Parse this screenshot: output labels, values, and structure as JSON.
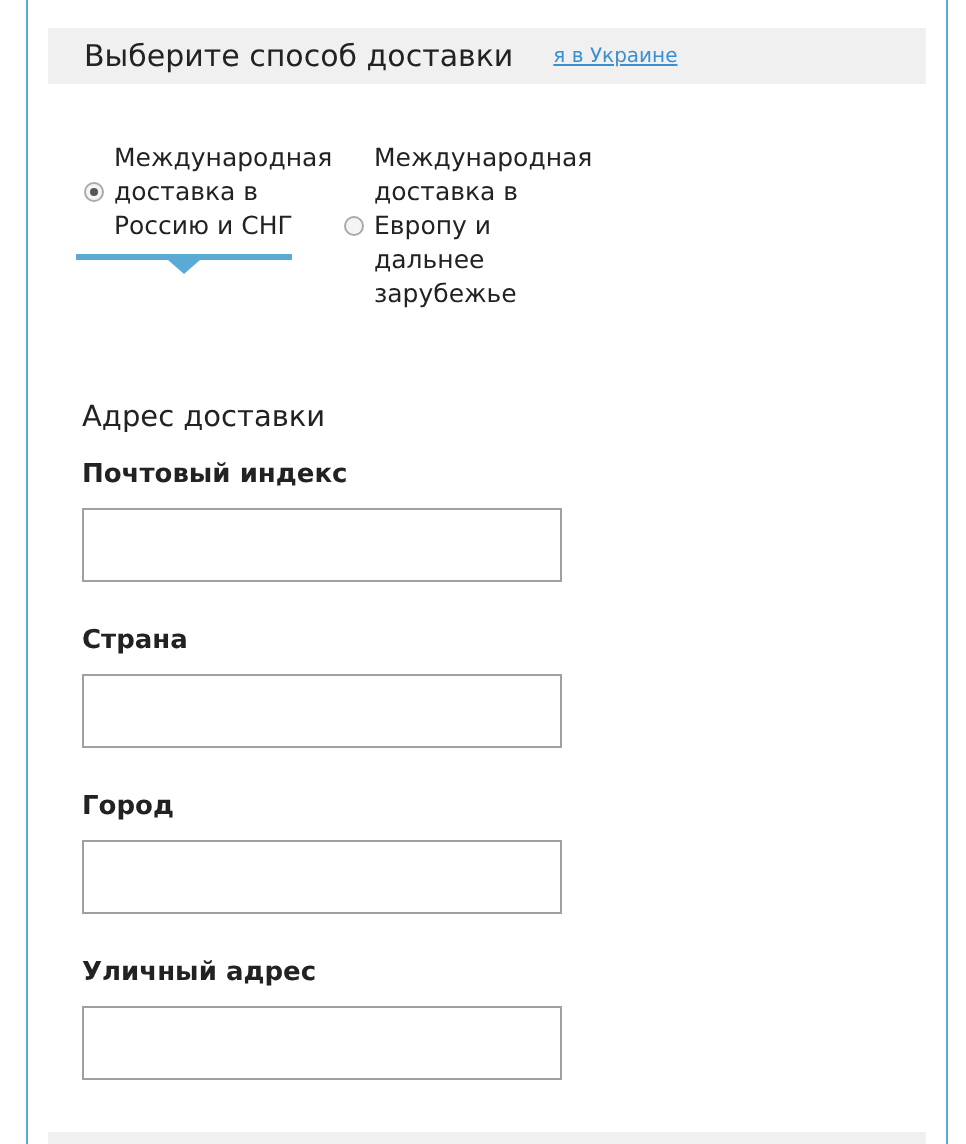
{
  "header": {
    "title": "Выберите способ доставки",
    "link": "я в Украине"
  },
  "options": [
    {
      "label": "Международная доставка в Россию и СНГ",
      "selected": true
    },
    {
      "label": "Международная доставка в Европу и дальнее зарубежье",
      "selected": false
    }
  ],
  "address": {
    "title": "Адрес доставки",
    "fields": [
      {
        "label": "Почтовый индекс"
      },
      {
        "label": "Страна"
      },
      {
        "label": "Город"
      },
      {
        "label": "Уличный адрес"
      }
    ]
  }
}
